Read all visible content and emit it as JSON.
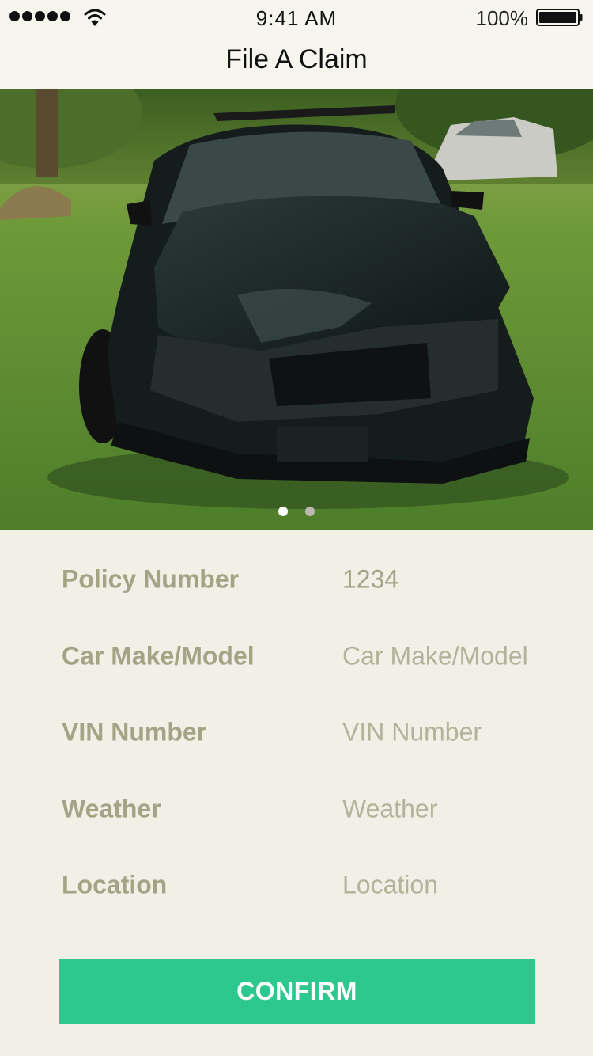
{
  "status_bar": {
    "time": "9:41 AM",
    "battery": "100%",
    "signal_icon": "signal-dots-icon",
    "wifi_icon": "wifi-icon",
    "battery_icon": "battery-icon"
  },
  "nav": {
    "title": "File A Claim"
  },
  "gallery": {
    "image": "damaged-car-photo",
    "page_count": 2,
    "current_page": 1,
    "dot_active_color": "#ffffff",
    "dot_inactive_color": "#b9b9b2"
  },
  "form": {
    "fields": [
      {
        "label": "Policy Number",
        "value": "1234",
        "placeholder": "Policy Number"
      },
      {
        "label": "Car Make/Model",
        "value": "",
        "placeholder": "Car Make/Model"
      },
      {
        "label": "VIN Number",
        "value": "",
        "placeholder": "VIN Number"
      },
      {
        "label": "Weather",
        "value": "",
        "placeholder": "Weather"
      },
      {
        "label": "Location",
        "value": "",
        "placeholder": "Location"
      }
    ]
  },
  "confirm": {
    "label": "CONFIRM",
    "color": "#2dc88e"
  },
  "colors": {
    "background": "#f1efe6",
    "label": "#a4a386"
  }
}
